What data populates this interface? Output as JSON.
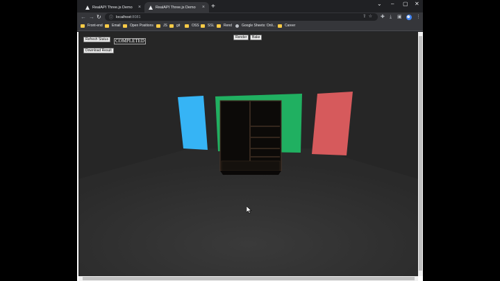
{
  "browser": {
    "tabs": [
      {
        "title": "RealAPI Three.js Demo",
        "active": false
      },
      {
        "title": "RealAPI Three.js Demo",
        "active": true
      }
    ],
    "address": {
      "host": "localhost",
      "port": ":8081"
    },
    "bookmarks": [
      {
        "label": "Front-end",
        "icon": "folder-icon"
      },
      {
        "label": "Email",
        "icon": "folder-icon"
      },
      {
        "label": "Open Positions",
        "icon": "folder-icon"
      },
      {
        "label": "JS",
        "icon": "folder-icon"
      },
      {
        "label": "git",
        "icon": "folder-icon"
      },
      {
        "label": "OSS",
        "icon": "folder-icon"
      },
      {
        "label": "SSL",
        "icon": "folder-icon"
      },
      {
        "label": "Rend",
        "icon": "folder-icon"
      },
      {
        "label": "Google Sheets: Onli...",
        "icon": "google-sheets-icon"
      },
      {
        "label": "Career",
        "icon": "folder-icon"
      }
    ]
  },
  "page": {
    "refresh_status_label": "Refresh Status",
    "status_value": "COMPLETED",
    "download_result_label": "Download Result",
    "render_label": "Render",
    "bake_label": "Bake"
  },
  "colors": {
    "panel_blue": "#36b4f5",
    "panel_green": "#20b061",
    "panel_red": "#d65a5c",
    "scene_bg": "#262626",
    "floor": "#2e2e2e"
  }
}
